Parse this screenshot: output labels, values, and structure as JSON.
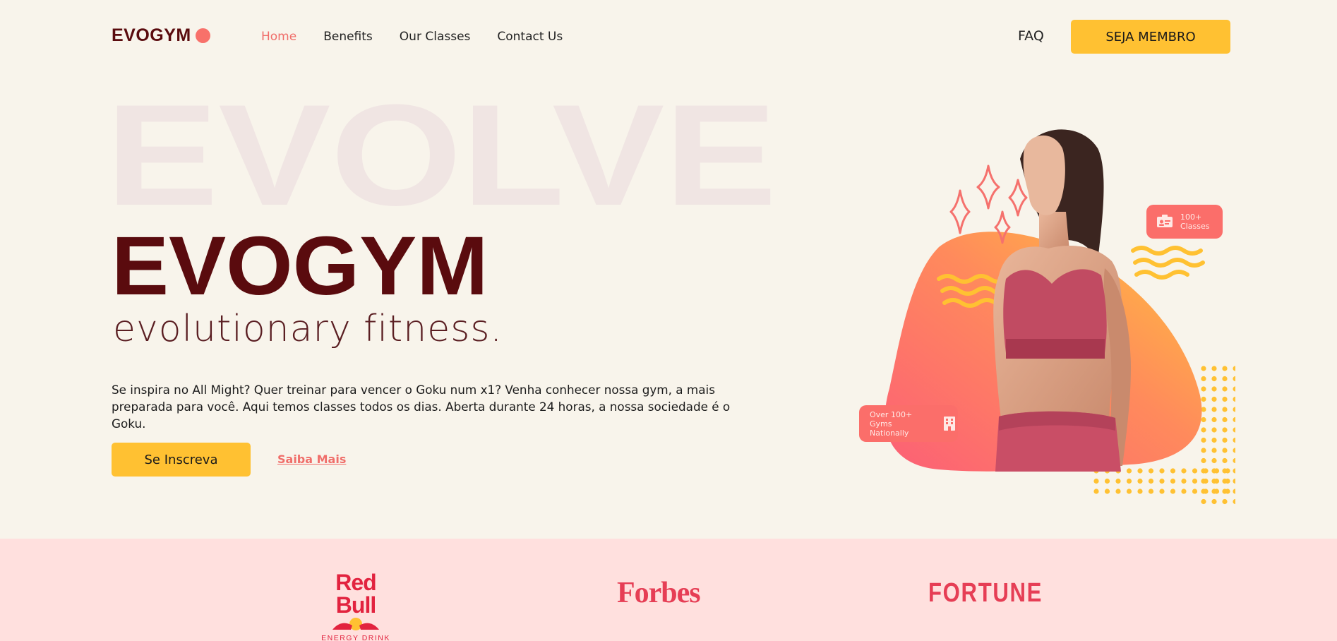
{
  "nav": {
    "logo": "EVOGYM",
    "links": [
      "Home",
      "Benefits",
      "Our Classes",
      "Contact Us"
    ],
    "active_index": 0,
    "faq": "FAQ",
    "member_button": "SEJA MEMBRO"
  },
  "hero": {
    "background_word": "EVOLVE",
    "title": "EVOGYM",
    "subtitle": "evolutionary fitness.",
    "description": "Se inspira no All Might? Quer treinar para vencer o Goku num x1? Venha conhecer nossa gym, a mais preparada para você. Aqui temos classes todos os dias. Aberta durante 24 horas, a nossa sociedade é o Goku.",
    "cta_button": "Se Inscreva",
    "learn_more": "Saiba Mais"
  },
  "badges": {
    "classes_line1": "100+",
    "classes_line2": "Classes",
    "gyms_line1": "Over 100+",
    "gyms_line2": "Gyms Nationally"
  },
  "partners": {
    "redbull": "Red Bull",
    "redbull_sub": "ENERGY DRINK",
    "forbes": "Forbes",
    "fortune": "FORTUNE"
  },
  "colors": {
    "background": "#f8f4eb",
    "accent_yellow": "#ffc132",
    "accent_coral": "#f8716a",
    "dark_red": "#5a0b0e",
    "partners_bg": "#ffe0de"
  }
}
